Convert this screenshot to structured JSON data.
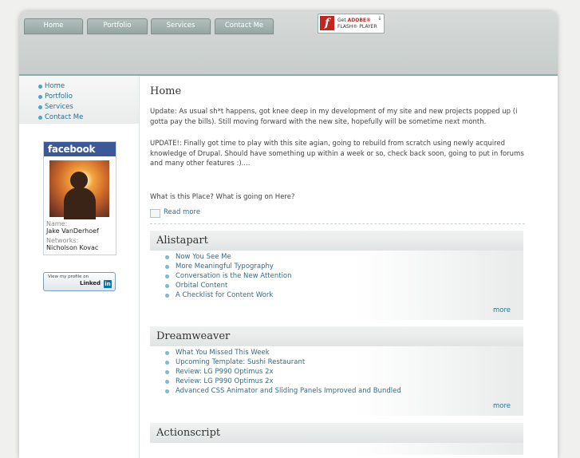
{
  "nav": {
    "tabs": [
      {
        "label": "Home"
      },
      {
        "label": "Portfolio"
      },
      {
        "label": "Services"
      },
      {
        "label": "Contact Me"
      }
    ]
  },
  "flash_badge": {
    "line1_prefix": "Get",
    "line1_brand": "ADOBE®",
    "line2": "FLASH® PLAYER",
    "icon": "flash-icon"
  },
  "sidebar": {
    "links": [
      {
        "label": "Home"
      },
      {
        "label": "Portfolio"
      },
      {
        "label": "Services"
      },
      {
        "label": "Contact Me"
      }
    ],
    "facebook": {
      "brand": "facebook",
      "name_label": "Name:",
      "name": "Jake VanDerhoef",
      "networks_label": "Networks:",
      "networks": "Nicholson Kovac"
    },
    "linkedin": {
      "line1": "View my profile on",
      "brand": "Linked",
      "in": "in"
    }
  },
  "main": {
    "title": "Home",
    "paragraphs": [
      "Update: As usual sh*t happens, got knee deep in my development of my site and new projects popped up (i gotta pay the bills). Still moving forward with the new site, hopefully will be sometime next month.",
      "UPDATE!: Finally got time to play with this site agian, going to rebuild from scratch using newly acquired knowledge of Drupal. Should have something up within a week or so, check back soon, going to put in forums and many other features :)....",
      "What is this Place? What is going on Here?"
    ],
    "read_more": "Read more"
  },
  "feeds": [
    {
      "title": "Alistapart",
      "items": [
        "Now You See Me",
        "More Meaningful Typography",
        "Conversation is the New Attention",
        "Orbital Content",
        "A Checklist for Content Work"
      ],
      "more": "more"
    },
    {
      "title": "Dreamweaver",
      "items": [
        "What You Missed This Week",
        "Upcoming Template: Sushi Restaurant",
        "Review: LG P990 Optimus 2x",
        "Review: LG P990 Optimus 2x",
        "Advanced CSS Animator and Sliding Panels Improved and Bundled"
      ],
      "more": "more"
    },
    {
      "title": "Actionscript",
      "items": [],
      "more": ""
    }
  ]
}
